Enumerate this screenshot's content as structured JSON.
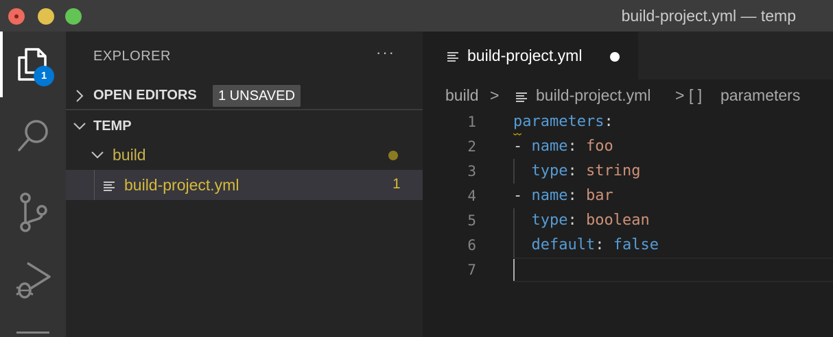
{
  "window": {
    "title": "build-project.yml — temp"
  },
  "activity_bar": {
    "items": [
      {
        "name": "explorer",
        "icon": "files-icon",
        "badge": "1"
      },
      {
        "name": "search",
        "icon": "search-icon"
      },
      {
        "name": "source-control",
        "icon": "source-control-icon"
      },
      {
        "name": "run-debug",
        "icon": "run-debug-icon"
      }
    ]
  },
  "sidebar": {
    "title": "EXPLORER",
    "more_actions": "···",
    "open_editors": {
      "label": "OPEN EDITORS",
      "badge": "1 UNSAVED"
    },
    "workspace": {
      "label": "TEMP",
      "folder": {
        "label": "build"
      },
      "file": {
        "label": "build-project.yml",
        "problems": "1"
      }
    }
  },
  "editor": {
    "tab": {
      "label": "build-project.yml",
      "dirty": true
    },
    "breadcrumb": {
      "folder": "build",
      "sep1": ">",
      "file": "build-project.yml",
      "sep2": ">",
      "symbol_icon": "[ ]",
      "symbol": "parameters"
    },
    "lines": [
      {
        "num": "1",
        "key": "parameters",
        "punct": ":"
      },
      {
        "num": "2",
        "dash": "- ",
        "key": "name",
        "punct": ": ",
        "value": "foo"
      },
      {
        "num": "3",
        "indent": "  ",
        "key": "type",
        "punct": ": ",
        "value": "string"
      },
      {
        "num": "4",
        "dash": "- ",
        "key": "name",
        "punct": ": ",
        "value": "bar"
      },
      {
        "num": "5",
        "indent": "  ",
        "key": "type",
        "punct": ": ",
        "value": "boolean"
      },
      {
        "num": "6",
        "indent": "  ",
        "key": "default",
        "punct": ": ",
        "value": "false"
      },
      {
        "num": "7"
      }
    ]
  },
  "colors": {
    "yaml_key": "#569cd6",
    "yaml_string": "#ce9178",
    "modified_file": "#d7ba3a",
    "badge_blue": "#0078d4"
  }
}
